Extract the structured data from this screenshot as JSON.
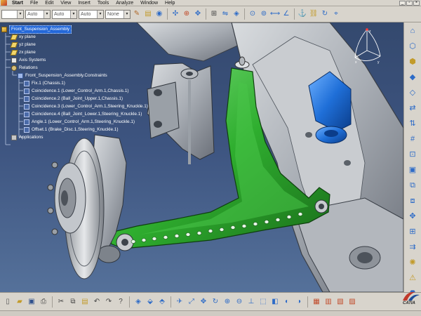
{
  "menu": {
    "items": [
      "Start",
      "File",
      "Edit",
      "View",
      "Insert",
      "Tools",
      "Analyze",
      "Window",
      "Help"
    ]
  },
  "toolbar_top": {
    "dropdowns": [
      {
        "value": ""
      },
      {
        "value": "Auto"
      },
      {
        "value": "Auto"
      },
      {
        "value": "Auto"
      },
      {
        "value": "None"
      }
    ]
  },
  "tree": {
    "root": "Front_Suspension_Assembly",
    "items": [
      {
        "label": "xy plane",
        "level": 1,
        "icon": "plane-icon"
      },
      {
        "label": "yz plane",
        "level": 1,
        "icon": "plane-icon"
      },
      {
        "label": "zx plane",
        "level": 1,
        "icon": "plane-icon"
      },
      {
        "label": "Axis Systems",
        "level": 1,
        "icon": "axis-icon"
      },
      {
        "label": "Relations",
        "level": 1,
        "icon": "relations-icon"
      },
      {
        "label": "Front_Suspension_Assembly.Constraints",
        "level": 2,
        "icon": "constraints-icon"
      },
      {
        "label": "Fix.1 (Chassis.1)",
        "level": 3,
        "icon": "fix-constraint-icon"
      },
      {
        "label": "Coincidence.1 (Lower_Control_Arm.1,Chassis.1)",
        "level": 3,
        "icon": "coincidence-icon"
      },
      {
        "label": "Coincidence.2 (Ball_Joint_Upper.1,Chassis.1)",
        "level": 3,
        "icon": "coincidence-icon"
      },
      {
        "label": "Coincidence.3 (Lower_Control_Arm.1,Steering_Knuckle.1)",
        "level": 3,
        "icon": "coincidence-icon"
      },
      {
        "label": "Coincidence.4 (Ball_Joint_Lower.1,Steering_Knuckle.1)",
        "level": 3,
        "icon": "coincidence-icon"
      },
      {
        "label": "Angle.1 (Lower_Control_Arm.1,Steering_Knuckle.1)",
        "level": 3,
        "icon": "angle-icon"
      },
      {
        "label": "Offset.1 (Brake_Disc.1,Steering_Knuckle.1)",
        "level": 3,
        "icon": "offset-icon"
      },
      {
        "label": "Applications",
        "level": 1,
        "icon": "applications-icon"
      }
    ]
  },
  "compass": {
    "axes": [
      "x",
      "y",
      "z"
    ]
  },
  "logo": {
    "text": "CATIA"
  },
  "colors": {
    "selected_part": "#2fae2f",
    "bracket_part": "#1f6fd8",
    "tree_selection": "#2468d8",
    "viewport_top": "#34496e",
    "viewport_bottom": "#55719a"
  }
}
